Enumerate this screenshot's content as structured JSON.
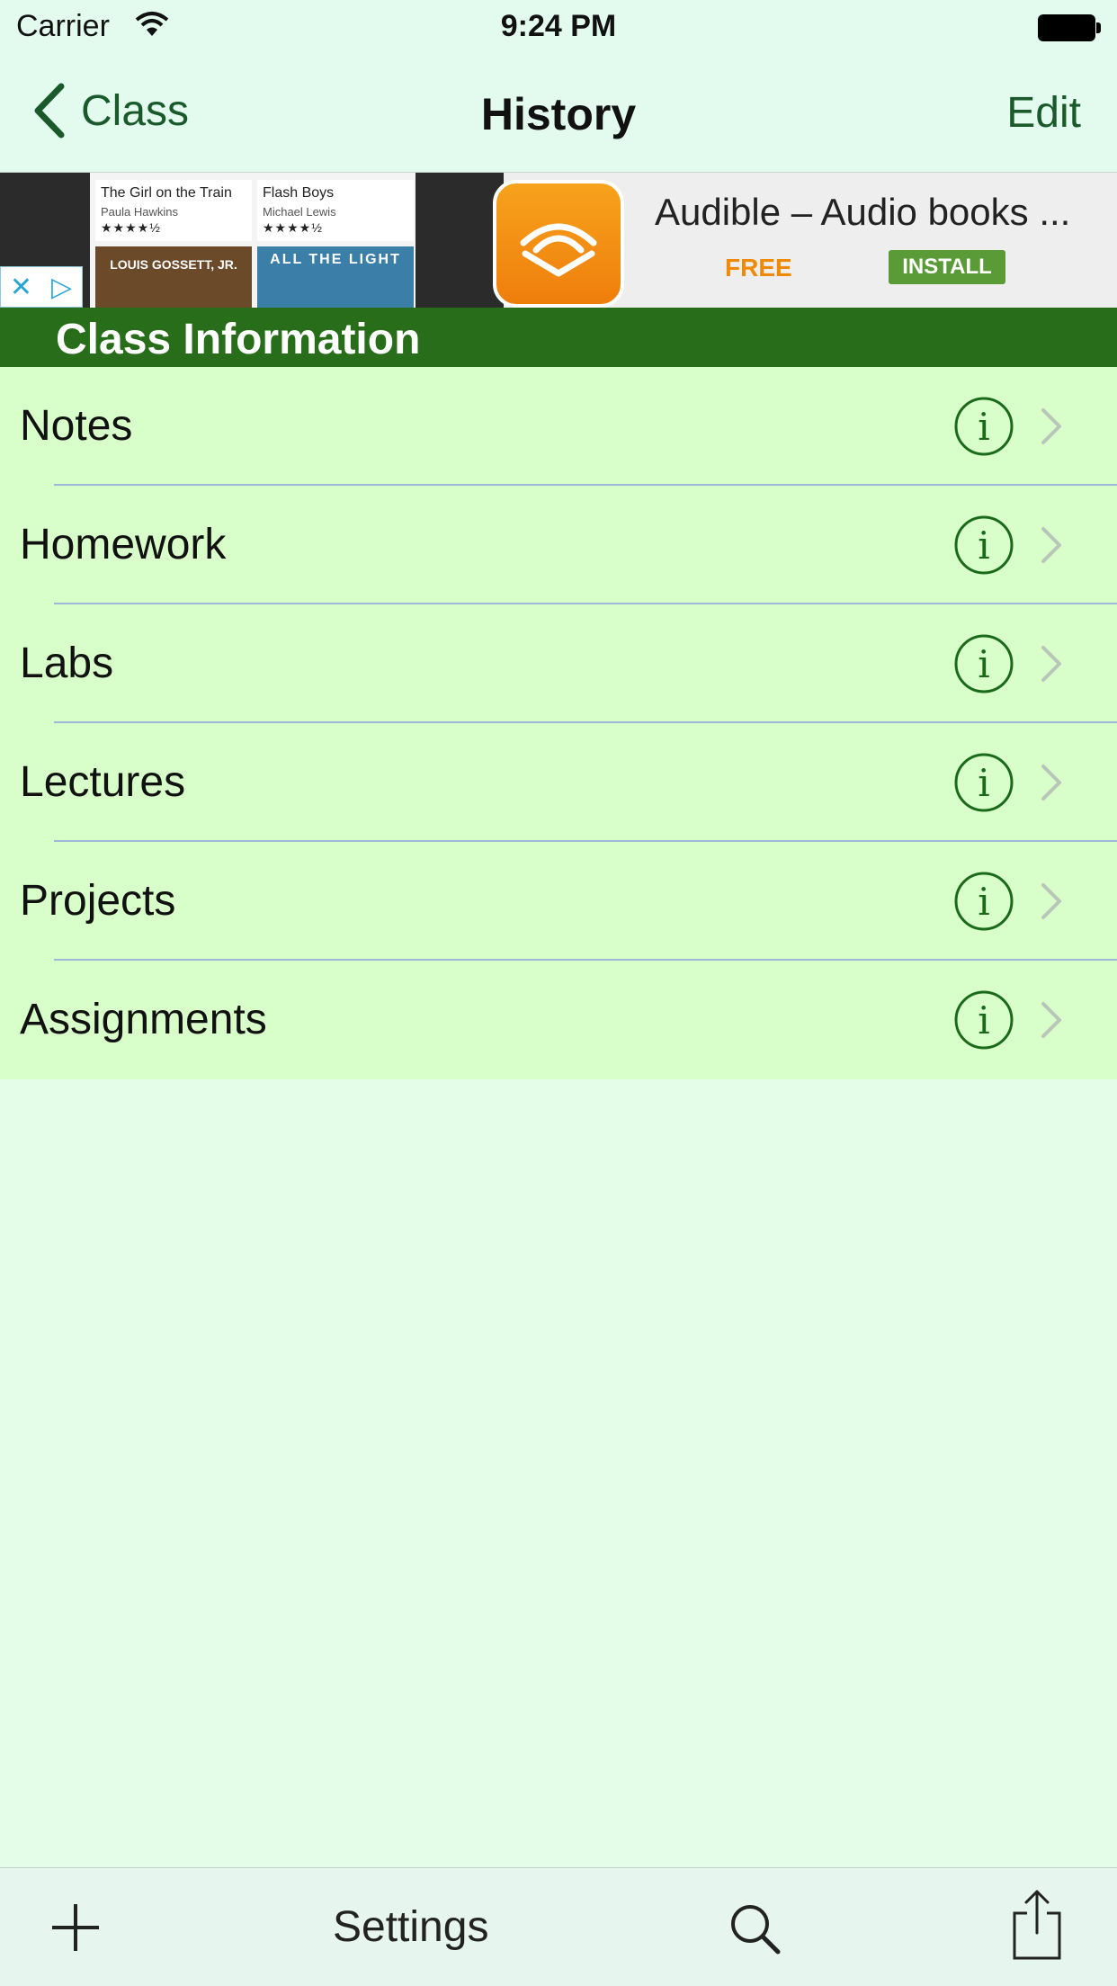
{
  "status_bar": {
    "carrier": "Carrier",
    "time": "9:24 PM"
  },
  "nav": {
    "back_label": "Class",
    "title": "History",
    "edit_label": "Edit"
  },
  "ad": {
    "books": [
      {
        "title": "The Girl on the Train",
        "author": "Paula Hawkins",
        "stars": "★★★★½"
      },
      {
        "title": "Flash Boys",
        "author": "Michael Lewis",
        "stars": "★★★★½"
      }
    ],
    "book_cover_a": "LOUIS GOSSETT, JR.",
    "book_cover_b": "ALL THE LIGHT",
    "app_title": "Audible – Audio books ...",
    "price": "FREE",
    "install_label": "INSTALL",
    "accent_orange": "#f08a00",
    "install_green": "#5a9a37"
  },
  "section": {
    "title": "Class Information",
    "header_color": "#286e1a"
  },
  "rows": [
    {
      "label": "Notes"
    },
    {
      "label": "Homework"
    },
    {
      "label": "Labs"
    },
    {
      "label": "Lectures"
    },
    {
      "label": "Projects"
    },
    {
      "label": "Assignments"
    }
  ],
  "row_icons": {
    "info": "info-icon",
    "disclosure": "chevron-right-icon"
  },
  "toolbar": {
    "add_icon": "plus-icon",
    "settings_label": "Settings",
    "search_icon": "search-icon",
    "share_icon": "share-icon"
  },
  "colors": {
    "background": "#e3fde9",
    "row_background": "#d8fec9",
    "tint": "#1a5a2a"
  }
}
